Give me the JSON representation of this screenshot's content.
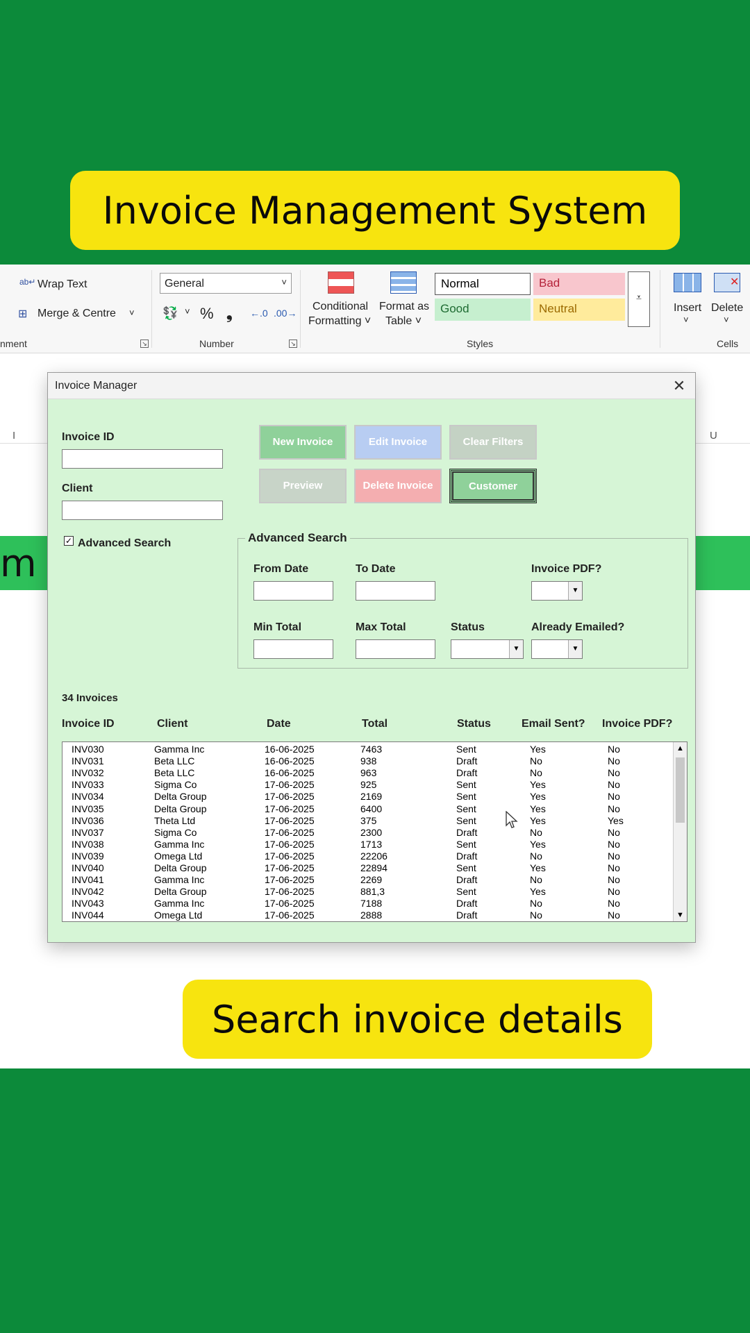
{
  "banners": {
    "top": "Invoice Management System",
    "bottom": "Search invoice details"
  },
  "ribbon": {
    "wrap_text": "Wrap Text",
    "merge_centre": "Merge & Centre",
    "alignment_label": "nment",
    "number_format": "General",
    "number_label": "Number",
    "percent_symbol": "%",
    "comma_symbol": "❟",
    "conditional_formatting_1": "Conditional",
    "conditional_formatting_2": "Formatting ˅",
    "format_as_table_1": "Format as",
    "format_as_table_2": "Table ˅",
    "styles_label": "Styles",
    "style_normal": "Normal",
    "style_bad": "Bad",
    "style_good": "Good",
    "style_neutral": "Neutral",
    "insert": "Insert",
    "delete": "Delete",
    "cells_label": "Cells",
    "chevron": "˅"
  },
  "sheet": {
    "col_i": "I",
    "col_u": "U",
    "left_fragment": "m"
  },
  "dialog": {
    "title": "Invoice Manager",
    "close": "✕",
    "invoice_id_label": "Invoice ID",
    "client_label": "Client",
    "invoice_id_value": "",
    "client_value": "",
    "advanced_search_checkbox": "Advanced Search",
    "checked_mark": "✓",
    "buttons": {
      "new_invoice": "New Invoice",
      "edit_invoice": "Edit Invoice",
      "clear_filters": "Clear Filters",
      "preview": "Preview",
      "delete_invoice": "Delete Invoice",
      "customer": "Customer"
    },
    "advanced": {
      "legend": "Advanced Search",
      "from_date": "From Date",
      "to_date": "To Date",
      "invoice_pdf": "Invoice PDF?",
      "min_total": "Min Total",
      "max_total": "Max Total",
      "status": "Status",
      "already_emailed": "Already Emailed?"
    },
    "count": "34 Invoices",
    "columns": [
      "Invoice ID",
      "Client",
      "Date",
      "Total",
      "Status",
      "Email Sent?",
      "Invoice PDF?"
    ],
    "rows": [
      [
        "INV030",
        "Gamma Inc",
        "16-06-2025",
        "7463",
        "Sent",
        "Yes",
        "No"
      ],
      [
        "INV031",
        "Beta LLC",
        "16-06-2025",
        "938",
        "Draft",
        "No",
        "No"
      ],
      [
        "INV032",
        "Beta LLC",
        "16-06-2025",
        "963",
        "Draft",
        "No",
        "No"
      ],
      [
        "INV033",
        "Sigma Co",
        "17-06-2025",
        "925",
        "Sent",
        "Yes",
        "No"
      ],
      [
        "INV034",
        "Delta Group",
        "17-06-2025",
        "2169",
        "Sent",
        "Yes",
        "No"
      ],
      [
        "INV035",
        "Delta Group",
        "17-06-2025",
        "6400",
        "Sent",
        "Yes",
        "No"
      ],
      [
        "INV036",
        "Theta Ltd",
        "17-06-2025",
        "375",
        "Sent",
        "Yes",
        "Yes"
      ],
      [
        "INV037",
        "Sigma Co",
        "17-06-2025",
        "2300",
        "Draft",
        "No",
        "No"
      ],
      [
        "INV038",
        "Gamma Inc",
        "17-06-2025",
        "1713",
        "Sent",
        "Yes",
        "No"
      ],
      [
        "INV039",
        "Omega Ltd",
        "17-06-2025",
        "22206",
        "Draft",
        "No",
        "No"
      ],
      [
        "INV040",
        "Delta Group",
        "17-06-2025",
        "22894",
        "Sent",
        "Yes",
        "No"
      ],
      [
        "INV041",
        "Gamma Inc",
        "17-06-2025",
        "2269",
        "Draft",
        "No",
        "No"
      ],
      [
        "INV042",
        "Delta Group",
        "17-06-2025",
        "881,3",
        "Sent",
        "Yes",
        "No"
      ],
      [
        "INV043",
        "Gamma Inc",
        "17-06-2025",
        "7188",
        "Draft",
        "No",
        "No"
      ],
      [
        "INV044",
        "Omega Ltd",
        "17-06-2025",
        "2888",
        "Draft",
        "No",
        "No"
      ]
    ]
  },
  "colors": {
    "background": "#0c8a3a",
    "banner": "#f7e40f",
    "dialog_bg": "#d6f5d6",
    "new_invoice": "#8fd19a",
    "edit_invoice": "#b8cdf2",
    "clear_filters": "#c4d2c4",
    "preview": "#c8d4c8",
    "delete_invoice": "#f4aeb0",
    "customer": "#8fd19a"
  }
}
